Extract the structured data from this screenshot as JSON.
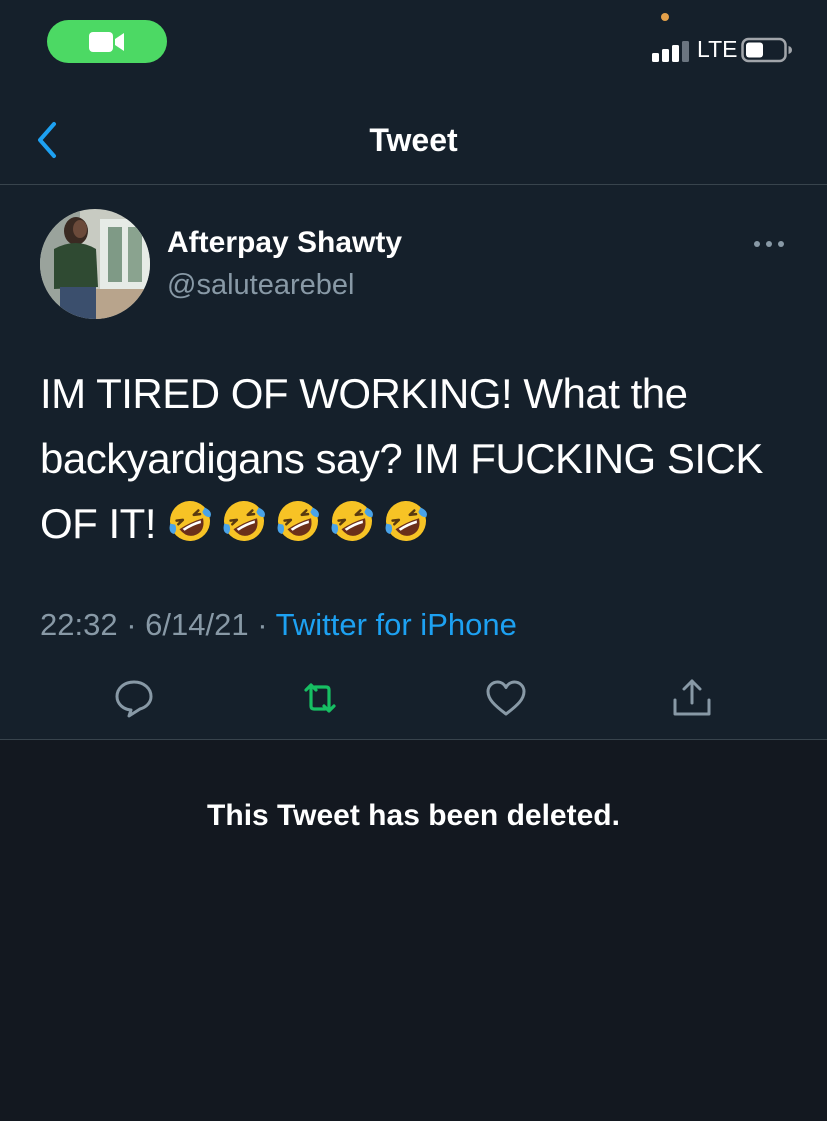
{
  "status_bar": {
    "network": "LTE",
    "facetime_icon": "video-camera-icon",
    "signal_icon": "cellular-signal-icon",
    "battery_icon": "battery-icon"
  },
  "nav": {
    "title": "Tweet",
    "back_icon": "chevron-left-icon"
  },
  "tweet": {
    "author": {
      "display_name": "Afterpay Shawty",
      "handle": "@salutearebel",
      "avatar": "profile-photo"
    },
    "text": "IM TIRED OF WORKING! What the backyardigans say? IM FUCKING SICK OF IT!",
    "emoji_name": "rolling-on-floor-laughing-emoji",
    "emoji_count": 5,
    "time": "22:32",
    "date": "6/14/21",
    "separator": "·",
    "source": "Twitter for iPhone",
    "actions": [
      "reply-icon",
      "retweet-icon",
      "like-icon",
      "share-icon"
    ],
    "more_icon": "more-horizontal-icon"
  },
  "deleted_notice": "This Tweet has been deleted.",
  "colors": {
    "background": "#15202b",
    "lower_background": "#131820",
    "accent": "#1da1f2",
    "retweet_green": "#17bf63",
    "facetime_green": "#4cd964",
    "secondary_text": "#8899a6",
    "divider": "#38444d"
  }
}
